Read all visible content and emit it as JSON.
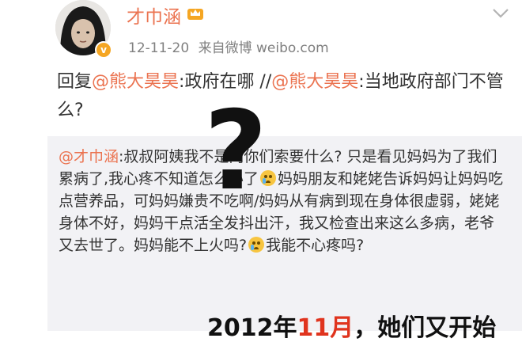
{
  "post": {
    "username": "才巾涵",
    "date": "12-11-20",
    "source": "来自微博 weibo.com",
    "reply": {
      "prefix": "回复",
      "mention1": "@熊大昊昊",
      "text1": ":政府在哪 //",
      "mention2": "@熊大昊昊",
      "text2": ":当地政府部门不管么?"
    }
  },
  "overlay": {
    "mark": "?",
    "caption_a": "2012年",
    "caption_red": "11月",
    "caption_b": "，她们又开始"
  },
  "quote": {
    "mention": "@才巾涵",
    "seg1": ":叔叔阿姨我不是向你们索要什么? 只是看见妈妈为了我们累病了,我心疼不知道怎么办了",
    "seg2": "妈妈朋友和姥姥告诉妈妈让妈妈吃点营养品，可妈妈嫌贵不吃啊/妈妈从有病到现在身体很虚弱，姥姥身体不好，妈妈干点活全发抖出汗，我又检查出来这么多病，老爷又去世了。妈妈能不上火吗?",
    "seg3": "我能不心疼吗?"
  },
  "icons": {
    "emoji": "crying-face-icon",
    "badge": "verified-badge-icon",
    "crown": "crown-icon",
    "menu": "chevron-down-icon"
  },
  "colors": {
    "link": "#eb7350",
    "quote_bg": "#f2f2f5",
    "badge": "#f5a623",
    "caption_red": "#e0341e"
  }
}
